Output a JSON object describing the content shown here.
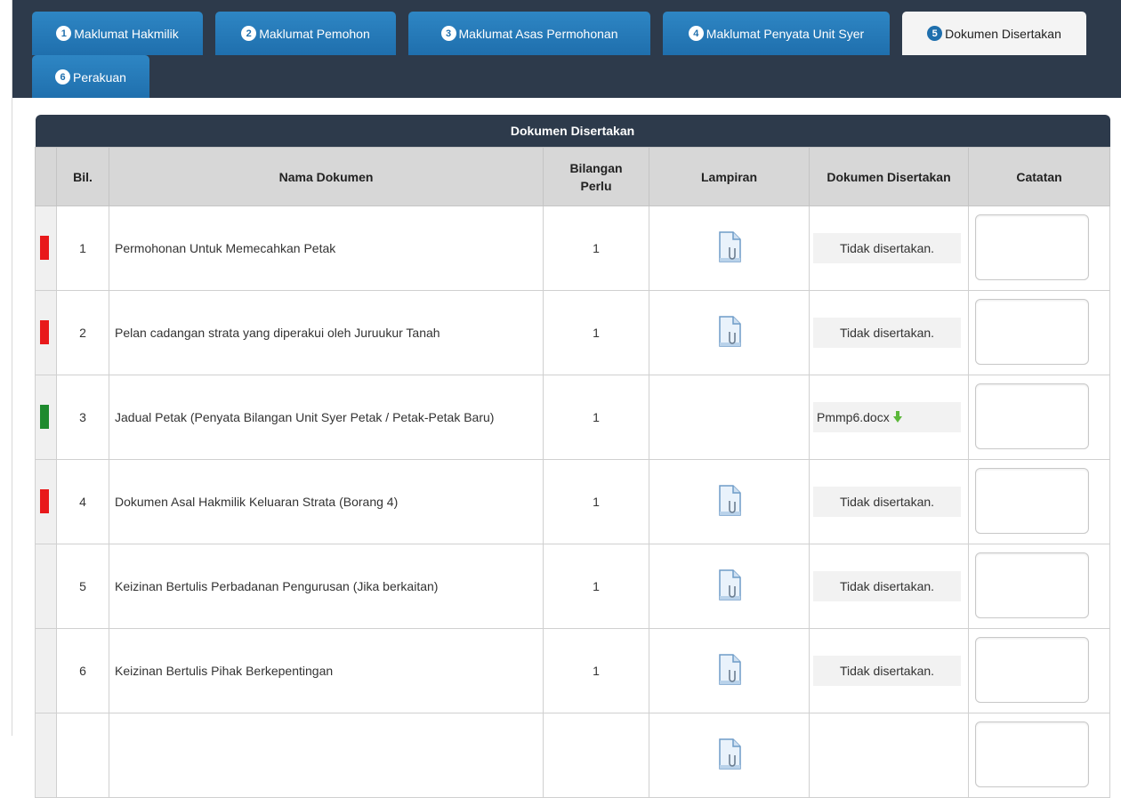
{
  "tabs": [
    {
      "num": "1",
      "label": "Maklumat Hakmilik",
      "active": false
    },
    {
      "num": "2",
      "label": "Maklumat Pemohon",
      "active": false
    },
    {
      "num": "3",
      "label": "Maklumat Asas Permohonan",
      "active": false
    },
    {
      "num": "4",
      "label": "Maklumat Penyata Unit Syer",
      "active": false
    },
    {
      "num": "5",
      "label": "Dokumen Disertakan",
      "active": true
    },
    {
      "num": "6",
      "label": "Perakuan",
      "active": false
    }
  ],
  "table": {
    "title": "Dokumen Disertakan",
    "headers": {
      "bil": "Bil.",
      "nama": "Nama Dokumen",
      "perlu": "Bilangan Perlu",
      "lampiran": "Lampiran",
      "disertakan": "Dokumen Disertakan",
      "catatan": "Catatan"
    },
    "rows": [
      {
        "bil": "1",
        "nama": "Permohonan Untuk Memecahkan Petak",
        "perlu": "1",
        "status": "Tidak disertakan.",
        "indicator": "#e8191b",
        "has_attach": true,
        "file": false
      },
      {
        "bil": "2",
        "nama": "Pelan cadangan strata yang diperakui oleh Juruukur Tanah",
        "perlu": "1",
        "status": "Tidak disertakan.",
        "indicator": "#e8191b",
        "has_attach": true,
        "file": false
      },
      {
        "bil": "3",
        "nama": "Jadual Petak (Penyata Bilangan Unit Syer Petak / Petak-Petak Baru)",
        "perlu": "1",
        "status": "Pmmp6.docx",
        "indicator": "#1e8a2e",
        "has_attach": false,
        "file": true
      },
      {
        "bil": "4",
        "nama": "Dokumen Asal Hakmilik Keluaran Strata (Borang 4)",
        "perlu": "1",
        "status": "Tidak disertakan.",
        "indicator": "#e8191b",
        "has_attach": true,
        "file": false
      },
      {
        "bil": "5",
        "nama": "Keizinan Bertulis Perbadanan Pengurusan (Jika berkaitan)",
        "perlu": "1",
        "status": "Tidak disertakan.",
        "indicator": "",
        "has_attach": true,
        "file": false
      },
      {
        "bil": "6",
        "nama": "Keizinan Bertulis Pihak Berkepentingan",
        "perlu": "1",
        "status": "Tidak disertakan.",
        "indicator": "",
        "has_attach": true,
        "file": false
      },
      {
        "bil": "",
        "nama": "",
        "perlu": "",
        "status": "",
        "indicator": "",
        "has_attach": true,
        "file": false
      }
    ]
  }
}
